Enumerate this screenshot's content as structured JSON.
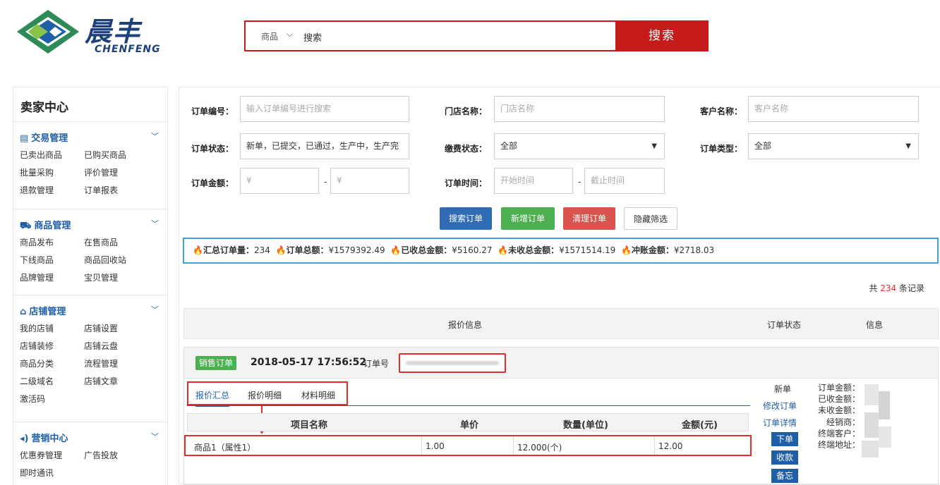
{
  "brand": {
    "name_cn": "晨丰",
    "name_en": "CHENFENG"
  },
  "search": {
    "category": "商品",
    "keyword": "搜索",
    "button": "搜索"
  },
  "sidebar": {
    "title": "卖家中心",
    "sections": [
      {
        "title": "交易管理",
        "items": [
          "已卖出商品",
          "已购买商品",
          "批量采购",
          "评价管理",
          "退款管理",
          "订单报表"
        ]
      },
      {
        "title": "商品管理",
        "items": [
          "商品发布",
          "在售商品",
          "下线商品",
          "商品回收站",
          "品牌管理",
          "宝贝管理"
        ]
      },
      {
        "title": "店铺管理",
        "items": [
          "我的店铺",
          "店铺设置",
          "店铺装修",
          "店铺云盘",
          "商品分类",
          "流程管理",
          "二级域名",
          "店铺文章",
          "激活码"
        ]
      },
      {
        "title": "营销中心",
        "items": [
          "优惠券管理",
          "广告投放",
          "即时通讯"
        ]
      }
    ]
  },
  "filters": {
    "order_no_label": "订单编号：",
    "order_no_placeholder": "输入订单编号进行搜索",
    "store_label": "门店名称：",
    "store_placeholder": "门店名称",
    "customer_label": "客户名称：",
    "customer_placeholder": "客户名称",
    "status_label": "订单状态：",
    "status_value": "新单，已提交，已通过，生产中，生产完",
    "pay_label": "缴费状态：",
    "pay_value": "全部",
    "type_label": "订单类型：",
    "type_value": "全部",
    "amount_label": "订单金额：",
    "amount_min": "¥",
    "amount_max": "¥",
    "time_label": "订单时间：",
    "time_start": "开始时间",
    "time_end": "截止时间",
    "range_sep": "-"
  },
  "actions": {
    "search": "搜索订单",
    "add": "新增订单",
    "clear": "清理订单",
    "hide": "隐藏筛选"
  },
  "colors": {
    "search": "#2f6cb5",
    "add": "#4caf50",
    "clear": "#d9534f",
    "brand_red": "#c51b1b"
  },
  "summary": {
    "count_label": "汇总订单量：",
    "count": "234",
    "total_label": "订单总额：",
    "total": "¥1579392.49",
    "received_label": "已收总金额：",
    "received": "¥5160.27",
    "unreceived_label": "未收总金额：",
    "unreceived": "¥1571514.19",
    "offset_label": "冲账金额：",
    "offset": "¥2718.03"
  },
  "records": {
    "prefix": "共 ",
    "count": "234",
    "suffix": " 条记录"
  },
  "table_header": {
    "quote": "报价信息",
    "status": "订单状态",
    "info": "信息"
  },
  "order": {
    "badge": "销售订单",
    "datetime": "2018-05-17 17:56:52",
    "no_label": "订单号",
    "tabs": [
      "报价汇总",
      "报价明细",
      "材料明细"
    ],
    "columns": [
      "项目名称",
      "单价",
      "数量(单位)",
      "金额(元)"
    ],
    "row": {
      "name": "商品1（属性1）",
      "price": "1.00",
      "qty": "12.000(个)",
      "amount": "12.00"
    },
    "status": "新单",
    "links": [
      "修改订单",
      "订单详情"
    ],
    "buttons": [
      "下单",
      "收款",
      "备忘"
    ],
    "info_labels": [
      "订单金额：",
      "已收金额：",
      "未收金额：",
      "经销商：",
      "终端客户：",
      "终端地址："
    ]
  }
}
